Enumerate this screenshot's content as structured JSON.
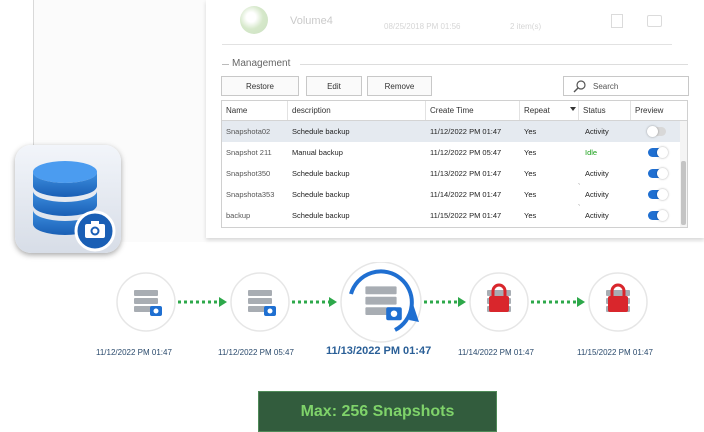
{
  "volume": {
    "name": "Volume4",
    "date": "08/25/2018 PM 01:56",
    "count": "2 item(s)"
  },
  "management": {
    "title": "Management",
    "buttons": {
      "restore": "Restore",
      "edit": "Edit",
      "remove": "Remove"
    },
    "search_placeholder": "Search"
  },
  "table": {
    "headers": {
      "name": "Name",
      "description": "description",
      "create_time": "Create Time",
      "repeat": "Repeat",
      "status": "Status",
      "preview": "Preview"
    },
    "rows": [
      {
        "name": "Snapshota02",
        "description": "Schedule backup",
        "create_time": "11/12/2022 PM 01:47",
        "repeat": "Yes",
        "status": "Activity",
        "preview_on": false,
        "selected": true
      },
      {
        "name": "Snapshot 211",
        "description": "Manual backup",
        "create_time": "11/12/2022 PM 05:47",
        "repeat": "Yes",
        "status": "Idle",
        "preview_on": true,
        "selected": false
      },
      {
        "name": "Snapshot350",
        "description": "Schedule backup",
        "create_time": "11/13/2022 PM 01:47",
        "repeat": "Yes",
        "status": "Activity",
        "preview_on": true,
        "selected": false
      },
      {
        "name": "Snapshota353",
        "description": "Schedule backup",
        "create_time": "11/14/2022 PM 01:47",
        "repeat": "Yes",
        "status": "Activity",
        "preview_on": true,
        "selected": false
      },
      {
        "name": "backup",
        "description": "Schedule backup",
        "create_time": "11/15/2022 PM 01:47",
        "repeat": "Yes",
        "status": "Activity",
        "preview_on": true,
        "selected": false
      }
    ]
  },
  "timeline": {
    "dates": [
      "11/12/2022 PM 01:47",
      "11/12/2022 PM 05:47",
      "11/13/2022 PM 01:47",
      "11/14/2022 PM 01:47",
      "11/15/2022 PM 01:47"
    ],
    "nodes": [
      "server-icon",
      "server-icon",
      "server-restore-icon",
      "locked-server-icon",
      "locked-server-icon"
    ]
  },
  "banner": {
    "text": "Max: 256 Snapshots"
  },
  "colors": {
    "accent": "#1f6fd1",
    "idle": "#1ba11b",
    "lock": "#d9262c",
    "banner_bg": "#325c3d",
    "banner_text": "#7fd36a",
    "arrow": "#2da84a"
  }
}
